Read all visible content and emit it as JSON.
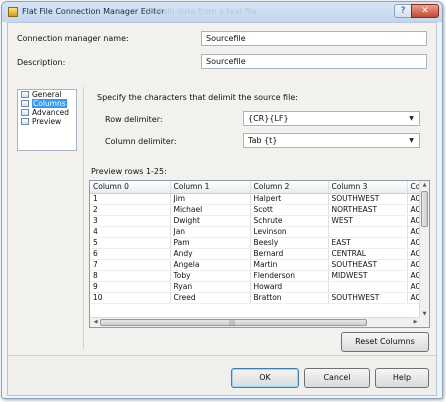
{
  "window": {
    "title": "Flat File Connection Manager Editor",
    "title_obscured": "Obtain data from a text file"
  },
  "form": {
    "name_label": "Connection manager name:",
    "name_value": "Sourcefile",
    "description_label": "Description:",
    "description_value": "Sourcefile"
  },
  "nav": {
    "items": [
      {
        "label": "General",
        "selected": false
      },
      {
        "label": "Columns",
        "selected": true
      },
      {
        "label": "Advanced",
        "selected": false
      },
      {
        "label": "Preview",
        "selected": false
      }
    ]
  },
  "columns_page": {
    "heading": "Specify the characters that delimit the source file:",
    "row_delimiter_label": "Row delimiter:",
    "row_delimiter_value": "{CR}{LF}",
    "column_delimiter_label": "Column delimiter:",
    "column_delimiter_value": "Tab {t}",
    "preview_label": "Preview rows 1-25:"
  },
  "grid": {
    "headers": [
      "Column 0",
      "Column 1",
      "Column 2",
      "Column 3",
      "Co"
    ],
    "rows": [
      [
        "1",
        "Jim",
        "Halpert",
        "SOUTHWEST",
        "AC"
      ],
      [
        "2",
        "Michael",
        "Scott",
        "NORTHEAST",
        "AC"
      ],
      [
        "3",
        "Dwight",
        "Schrute",
        "WEST",
        "AC"
      ],
      [
        "4",
        "Jan",
        "Levinson",
        "",
        "AC"
      ],
      [
        "5",
        "Pam",
        "Beesly",
        "EAST",
        "AC"
      ],
      [
        "6",
        "Andy",
        "Bernard",
        "CENTRAL",
        "AC"
      ],
      [
        "7",
        "Angela",
        "Martin",
        "SOUTHEAST",
        "AC"
      ],
      [
        "8",
        "Toby",
        "Flenderson",
        "MIDWEST",
        "AC"
      ],
      [
        "9",
        "Ryan",
        "Howard",
        "",
        "AC"
      ],
      [
        "10",
        "Creed",
        "Bratton",
        "SOUTHWEST",
        "AC"
      ]
    ]
  },
  "buttons": {
    "reset_columns": "Reset Columns",
    "ok": "OK",
    "cancel": "Cancel",
    "help": "Help"
  },
  "colors": {
    "selection": "#3399ff",
    "close_button": "#c24a33",
    "titlebar": "#c2d6ee"
  },
  "icons": {
    "app": "flat-file-icon",
    "close": "close-icon",
    "help": "help-icon",
    "nav_page": "page-icon"
  }
}
